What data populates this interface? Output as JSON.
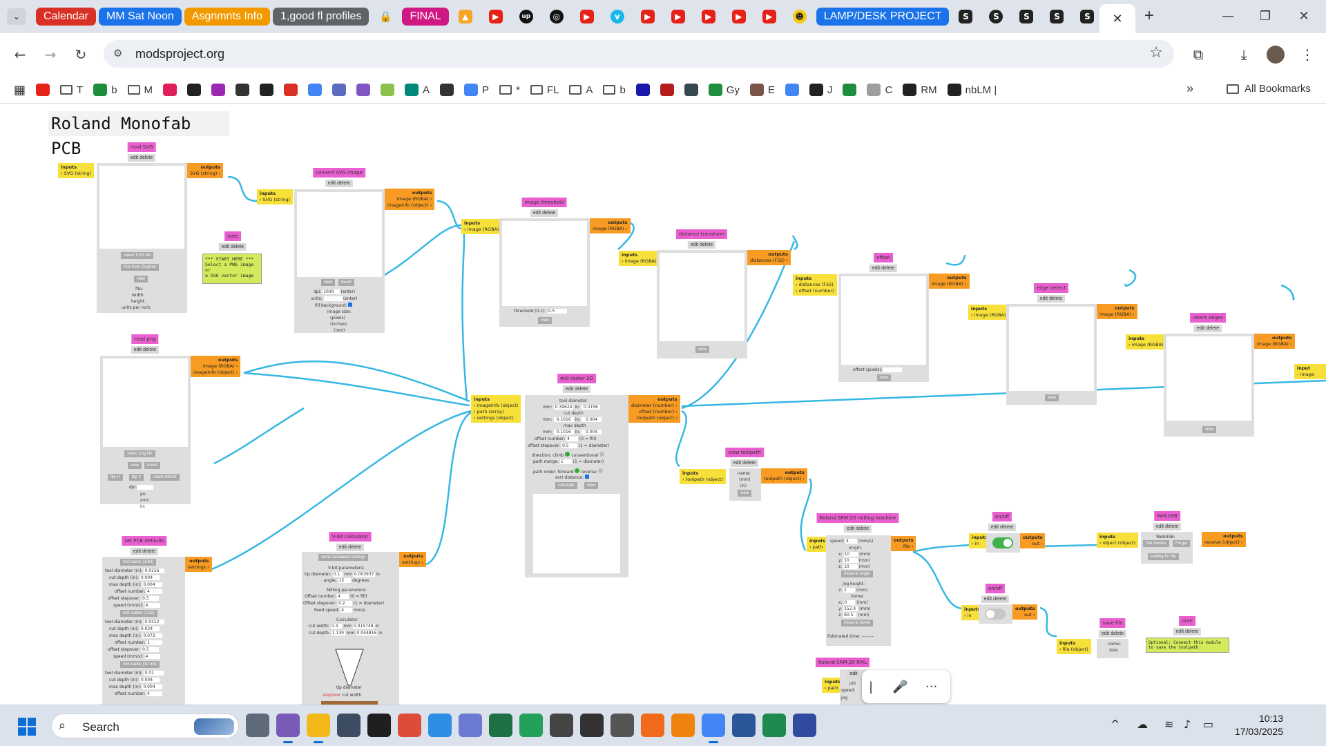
{
  "tabs": {
    "groups": [
      {
        "label": "Calendar",
        "color": "#d93025"
      },
      {
        "label": "MM Sat Noon",
        "color": "#1a73e8"
      },
      {
        "label": "Asgnmnts Info",
        "color": "#f29900"
      },
      {
        "label": "1,good fl profiles",
        "color": "#5f6368"
      }
    ],
    "final_group": {
      "label": "FINAL",
      "color": "#d01884"
    },
    "lamp_group": {
      "label": "LAMP/DESK PROJECT",
      "color": "#1a73e8"
    },
    "icons": [
      "lock-icon",
      "image-icon",
      "youtube-icon",
      "upwork-icon",
      "openai-icon",
      "youtube-icon",
      "vimeo-icon",
      "youtube-icon",
      "youtube-icon",
      "youtube-icon",
      "youtube-icon",
      "youtube-icon",
      "sunglasses-emoji-icon"
    ],
    "s_tabs": 6,
    "close": "✕",
    "new": "+"
  },
  "window": {
    "minimize": "—",
    "restore": "❐",
    "close": "✕"
  },
  "toolbar": {
    "url": "modsproject.org",
    "back": "←",
    "forward": "→",
    "reload": "↻"
  },
  "bookmarks": {
    "items": [
      {
        "label": "",
        "icon": "youtube-icon",
        "color": "#e62117"
      },
      {
        "label": "T",
        "icon": "folder-icon",
        "color": ""
      },
      {
        "label": "b",
        "icon": "plus-icon",
        "color": "#1e8e3e"
      },
      {
        "label": "M",
        "icon": "folder-icon",
        "color": ""
      },
      {
        "label": "",
        "icon": "slack-icon",
        "color": "#e01e5a"
      },
      {
        "label": "",
        "icon": "upwork-icon",
        "color": "#222"
      },
      {
        "label": "",
        "icon": "app-icon",
        "color": "#9c27b0"
      },
      {
        "label": "",
        "icon": "car-icon",
        "color": "#333"
      },
      {
        "label": "",
        "icon": "openai-icon",
        "color": "#222"
      },
      {
        "label": "",
        "icon": "gmail-icon",
        "color": "#d93025"
      },
      {
        "label": "",
        "icon": "gemini-icon",
        "color": "#4285f4"
      },
      {
        "label": "",
        "icon": "app-icon",
        "color": "#5c6bc0"
      },
      {
        "label": "",
        "icon": "app-icon",
        "color": "#7e57c2"
      },
      {
        "label": "",
        "icon": "app-icon",
        "color": "#8bc34a"
      },
      {
        "label": "A",
        "icon": "app-icon",
        "color": "#00897b"
      },
      {
        "label": "",
        "icon": "app-icon",
        "color": "#333"
      },
      {
        "label": "P",
        "icon": "google-icon",
        "color": "#4285f4"
      },
      {
        "label": "*",
        "icon": "folder-icon",
        "color": ""
      },
      {
        "label": "FL",
        "icon": "folder-icon",
        "color": ""
      },
      {
        "label": "A",
        "icon": "folder-icon",
        "color": ""
      },
      {
        "label": "b",
        "icon": "folder-icon",
        "color": ""
      },
      {
        "label": "",
        "icon": "badge-10-icon",
        "color": "#1a1aaa"
      },
      {
        "label": "",
        "icon": "app-icon",
        "color": "#b71c1c"
      },
      {
        "label": "",
        "icon": "app-icon",
        "color": "#37474f"
      },
      {
        "label": "Gy",
        "icon": "plus-icon",
        "color": "#1e8e3e"
      },
      {
        "label": "E",
        "icon": "app-icon",
        "color": "#795548"
      },
      {
        "label": "",
        "icon": "gemini-icon",
        "color": "#4285f4"
      },
      {
        "label": "J",
        "icon": "amazon-icon",
        "color": "#222"
      },
      {
        "label": "",
        "icon": "plus-icon",
        "color": "#1e8e3e"
      },
      {
        "label": "C",
        "icon": "app-icon",
        "color": "#9e9e9e"
      },
      {
        "label": "RM",
        "icon": "app-icon",
        "color": "#222"
      },
      {
        "label": "nbLM |",
        "icon": "app-icon",
        "color": "#222"
      }
    ],
    "more": "»",
    "all": "All Bookmarks"
  },
  "canvas": {
    "title": "Roland Monofab PCB",
    "modules": {
      "read_svg": {
        "title": "read SVG",
        "edit": "edit delete",
        "in_label": "inputs",
        "in": "› SVG (string)",
        "out_label": "outputs",
        "out": "SVG (string) ›",
        "btn1": "select SVG file",
        "btn2": "Pull from DogFab",
        "btn3": "view",
        "info1": "file:",
        "info2": "width:",
        "info3": "height:",
        "info4": "units per inch:"
      },
      "note1": {
        "title": "note",
        "edit": "edit delete",
        "text1": "*** START HERE ***",
        "text2": "Select a PNG image or",
        "text3": "a SVG vector image"
      },
      "convert_svg": {
        "title": "convert SVG image",
        "edit": "edit delete",
        "in_label": "inputs",
        "in": "› SVG (string)",
        "out_label": "outputs",
        "out1": "image (RGBA) ›",
        "out2": "imageInfo (object) ›",
        "btn1": "view",
        "btn2": "invert",
        "dpi": "dpi:",
        "dpi_val": "1000",
        "dpi_hint": "(enter)",
        "units": "units:",
        "units_hint": "(enter)",
        "fill": "fill background:",
        "size1": "image size:",
        "size2": "(pixels)",
        "size3": "(inches)",
        "size4": "(mm)"
      },
      "threshold": {
        "title": "image threshold",
        "edit": "edit delete",
        "in_label": "inputs",
        "in": "› image (RGBA)",
        "out_label": "outputs",
        "out": "image (RGBA) ›",
        "label": "threshold (0-1):",
        "val": "0.5",
        "btn": "view"
      },
      "distance": {
        "title": "distance transform",
        "edit": "edit delete",
        "in_label": "inputs",
        "in": "› image (RGBA)",
        "out_label": "outputs",
        "out": "distances (F32) ›",
        "btn": "view"
      },
      "offset": {
        "title": "offset",
        "edit": "edit delete",
        "in_label": "inputs",
        "in1": "› distances (F32)",
        "in2": "› offset (number)",
        "out_label": "outputs",
        "out": "image (RGBA) ›",
        "label": "offset (pixels):",
        "btn": "view"
      },
      "edge": {
        "title": "edge detect",
        "edit": "edit delete",
        "in_label": "inputs",
        "in": "› image (RGBA)",
        "out_label": "outputs",
        "out": "image (RGBA) ›",
        "btn": "view"
      },
      "orient": {
        "title": "orient edges",
        "edit": "edit delete",
        "in_label": "inputs",
        "in": "› image (RGBA)",
        "out_label": "outputs",
        "out": "image (RGBA) ›",
        "btn": "view"
      },
      "far_right": {
        "in_label": "input",
        "in": "› image"
      },
      "read_png": {
        "title": "read png",
        "edit": "edit delete",
        "out_label": "outputs",
        "out1": "image (RGBA) ›",
        "out2": "imageInfo (object) ›",
        "btn1": "select png file",
        "btn2": "view",
        "btn3": "invert",
        "btn4": "flip H",
        "btn5": "flip V",
        "btn6": "rotate 90CW",
        "dpi": "dpi:",
        "px": "px:",
        "mm": "mm:",
        "in": "in:"
      },
      "mill": {
        "title": "mill raster 2D",
        "edit": "edit delete",
        "in_label": "inputs",
        "in1": "› imageInfo (object)",
        "in2": "› path (array)",
        "in3": "› settings (object)",
        "out_label": "outputs",
        "out1": "diameter (number) ›",
        "out2": "offset (number) ›",
        "out3": "toolpath (object) ›",
        "l1": "tool diameter",
        "l2": "mm:",
        "v2": "0.39624",
        "l3": "in:",
        "v3": "0.0156",
        "l4": "cut depth",
        "l5": "mm:",
        "v5": "0.1016",
        "l6": "in:",
        "v6": "0.004",
        "l7": "max depth",
        "l8": "mm:",
        "v8": "0.1016",
        "l9": "in:",
        "v9": "0.004",
        "l10": "offset number:",
        "v10": "4",
        "l10b": "(0 = fill)",
        "l11": "offset stepover:",
        "v11": "0.5",
        "l11b": "(1 = diameter)",
        "l12": "direction: climb",
        "l12b": "conventional",
        "l13": "path merge:",
        "v13": "1",
        "l13b": "(1 = diameter)",
        "l14": "path order: forward",
        "l14b": "reverse",
        "l15": "sort distance:",
        "btn1": "calculate",
        "btn2": "view"
      },
      "view_toolpath": {
        "title": "view toolpath",
        "edit": "edit delete",
        "in_label": "inputs",
        "in": "› toolpath (object)",
        "out_label": "outputs",
        "out": "toolpath (object) ›",
        "name": "name:",
        "mm": "(mm)",
        "in_unit": "(in)",
        "btn": "view"
      },
      "srm": {
        "title": "Roland SRM-20 milling machine",
        "edit": "edit delete",
        "in_label": "inputs",
        "in": "› path",
        "out_label": "outputs",
        "out": "file ›",
        "speed": "speed:",
        "speed_val": "4",
        "speed_unit": "(mm/s)",
        "origin": "origin:",
        "x": "x:",
        "xv": "10",
        "y": "y:",
        "yv": "10",
        "z": "z:",
        "zv": "10",
        "unit": "(mm)",
        "btn1": "move to origin",
        "jog": "jog height:",
        "jogv": "2",
        "home": "home:",
        "hx": "0",
        "hy": "152.4",
        "hz": "60.5",
        "btn2": "move to home",
        "est": "Estimated time: --:--:--"
      },
      "onoff1": {
        "title": "on/off",
        "edit": "edit delete",
        "in_label": "inputs",
        "in": "› in",
        "out_label": "outputs",
        "out": "out ›",
        "state": "on"
      },
      "webusb": {
        "title": "WebUSB",
        "edit": "edit delete",
        "in_label": "inputs",
        "in": "› object (object)",
        "out_label": "outputs",
        "out": "receive (object) ›",
        "label": "WebUSB:",
        "btn1": "Get Device",
        "btn2": "Forget",
        "btn3": "waiting for file"
      },
      "onoff2": {
        "title": "on/off",
        "edit": "edit delete",
        "in_label": "inputs",
        "in": "› in",
        "out_label": "outputs",
        "out": "out ›",
        "state": "off"
      },
      "save": {
        "title": "save file",
        "edit": "edit delete",
        "in_label": "inputs",
        "in": "› file (object)",
        "name": "name:",
        "size": "size:"
      },
      "note2": {
        "title": "note",
        "edit": "edit delete",
        "text1": "Optional: Connect this module",
        "text2": "to save the toolpath"
      },
      "pcb": {
        "title": "set PCB defaults",
        "edit": "edit delete",
        "out_label": "outputs",
        "out": "settings ›",
        "b1": "mill traces (1/64)",
        "r1": "tool diameter (in):",
        "r1v": "0.0156",
        "r2": "cut depth (in):",
        "r2v": "0.004",
        "r3": "max depth (in):",
        "r3v": "0.004",
        "r4": "offset number:",
        "r4v": "4",
        "r5": "offset stepover:",
        "r5v": "0.5",
        "r6": "speed (mm/s):",
        "r6v": "4",
        "b2": "mill outline (1/32)",
        "s1": "tool diameter (in):",
        "s1v": "0.0312",
        "s2": "cut depth (in):",
        "s2v": "0.024",
        "s3": "max depth (in):",
        "s3v": "0.072",
        "s4": "offset number:",
        "s4v": "1",
        "s5": "offset stepover:",
        "s5v": "0.5",
        "s6": "speed (mm/s):",
        "s6v": "4",
        "b3": "mill traces (10 mil)",
        "t1": "tool diameter (in):",
        "t1v": "0.01",
        "t2": "cut depth (in):",
        "t2v": "0.004",
        "t3": "max depth (in):",
        "t3v": "0.004",
        "t4": "offset number:",
        "t4v": "4"
      },
      "vbit": {
        "title": "V-bit calculator",
        "edit": "edit delete",
        "out_label": "outputs",
        "out": "settings ›",
        "btn": "send calculated settings",
        "p1": "V-bit parameters:",
        "p2": "tip diameter:",
        "p2v": "0.1",
        "p2u": "mm",
        "p2i": "0.003937",
        "p2iu": "in",
        "p3": "angle:",
        "p3v": "15",
        "p3u": "degrees",
        "p4": "Milling parameters:",
        "p5": "Offset number:",
        "p5v": "4",
        "p5u": "(0 = fill)",
        "p6": "Offset stepover:",
        "p6v": "0.2",
        "p6u": "(1 = diameter)",
        "p7": "Feed speed:",
        "p7v": "4",
        "p7u": "mm/s",
        "p8": "Calculator:",
        "p9": "cut width:",
        "p9v": "0.4",
        "p9m": "mm",
        "p9i": "0.015748",
        "p9iu": "in",
        "p10": "cut depth:",
        "p10v": "1.139",
        "p10m": "mm",
        "p10i": "0.044816",
        "p10iu": "in",
        "angle_lbl": "angle",
        "tip_lbl": "tip diameter",
        "sc1": "stepover",
        "sc2": "cut width"
      },
      "srm_rml": {
        "title": "Roland SRM-20 RML",
        "edit": "edit",
        "in_label": "inputs",
        "in": "› path",
        "j": "job",
        "sp": "speed:",
        "jg": "jog"
      }
    }
  },
  "dock": {
    "a": "|",
    "b": "🎤",
    "c": "···"
  },
  "taskbar": {
    "search": "Search",
    "apps": [
      {
        "icon": "task-view-icon",
        "color": "#5f6b7a",
        "on": false
      },
      {
        "icon": "browser-icon",
        "color": "#7a5ab8",
        "on": true
      },
      {
        "icon": "file-explorer-icon",
        "color": "#f3b81a",
        "on": true
      },
      {
        "icon": "calculator-icon",
        "color": "#3b4c63",
        "on": false
      },
      {
        "icon": "app-icon",
        "color": "#1f1f1f",
        "on": false
      },
      {
        "icon": "chrome-icon",
        "color": "#dd4b39",
        "on": false
      },
      {
        "icon": "notepad-icon",
        "color": "#2d8ee6",
        "on": false
      },
      {
        "icon": "snipping-icon",
        "color": "#6c7bd1",
        "on": false
      },
      {
        "icon": "excel-icon",
        "color": "#1e7145",
        "on": false
      },
      {
        "icon": "kicad-icon",
        "color": "#23a05a",
        "on": false
      },
      {
        "icon": "app-icon",
        "color": "#444",
        "on": false
      },
      {
        "icon": "inkscape-icon",
        "color": "#333",
        "on": false
      },
      {
        "icon": "rhino-icon",
        "color": "#555",
        "on": false
      },
      {
        "icon": "fusion-icon",
        "color": "#f26a1b",
        "on": false
      },
      {
        "icon": "blender-icon",
        "color": "#f0820f",
        "on": false
      },
      {
        "icon": "chrome-icon",
        "color": "#4285f4",
        "on": true
      },
      {
        "icon": "word-icon",
        "color": "#2b579a",
        "on": false
      },
      {
        "icon": "kicad-icon",
        "color": "#1e8a50",
        "on": false
      },
      {
        "icon": "kicad-ki-icon",
        "color": "#314c9e",
        "on": false
      }
    ],
    "time": "10:13",
    "date": "17/03/2025",
    "tray_up": "^"
  }
}
